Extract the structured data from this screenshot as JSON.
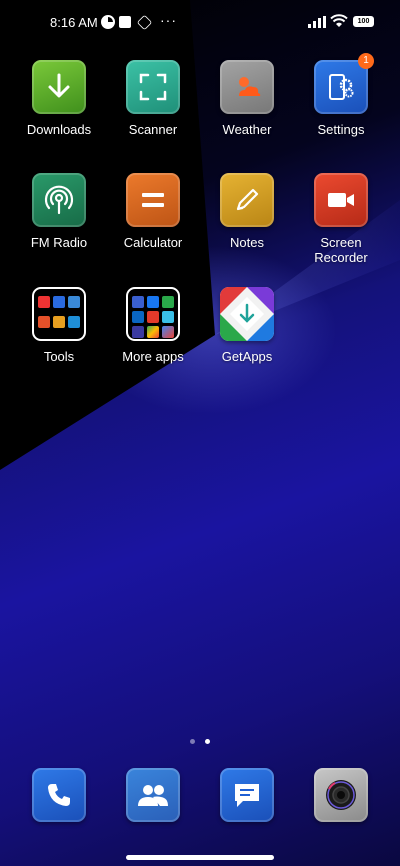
{
  "status_bar": {
    "time": "8:16 AM",
    "left_icons": [
      "data-saver-icon",
      "square-icon",
      "hex-icon",
      "more-dots-icon"
    ],
    "more_text": "···",
    "right_icons": [
      "signal-icon",
      "wifi-icon",
      "battery-icon"
    ],
    "battery_level": "100"
  },
  "apps": [
    {
      "label": "Downloads",
      "icon": "download-arrow-icon",
      "color": "#5aa52a"
    },
    {
      "label": "Scanner",
      "icon": "scan-frame-icon",
      "color": "#2aa88f"
    },
    {
      "label": "Weather",
      "icon": "weather-cloud-sun-icon",
      "color": "#8c8c8c"
    },
    {
      "label": "Settings",
      "icon": "phone-gear-icon",
      "color": "#1f5fd4",
      "badge": "1"
    },
    {
      "label": "FM Radio",
      "icon": "radio-antenna-icon",
      "color": "#1f8a5a"
    },
    {
      "label": "Calculator",
      "icon": "equals-icon",
      "color": "#d8661f"
    },
    {
      "label": "Notes",
      "icon": "pencil-icon",
      "color": "#d9a21f"
    },
    {
      "label": "Screen\nRecorder",
      "label_line1": "Screen",
      "label_line2": "Recorder",
      "icon": "video-camera-icon",
      "color": "#d83a25"
    },
    {
      "label": "Tools",
      "icon": "folder-icon"
    },
    {
      "label": "More apps",
      "icon": "folder-icon"
    },
    {
      "label": "GetApps",
      "icon": "getapps-diamond-icon"
    }
  ],
  "page_indicator": {
    "pages": 2,
    "active_page": 2
  },
  "dock": [
    {
      "name": "phone",
      "icon": "phone-handset-icon",
      "color": "#1f5fd4"
    },
    {
      "name": "contacts",
      "icon": "contacts-people-icon",
      "color": "#2d6fd0"
    },
    {
      "name": "messages",
      "icon": "message-bubble-icon",
      "color": "#1f5fd4"
    },
    {
      "name": "camera",
      "icon": "camera-lens-icon",
      "color": "#a8a8a8"
    }
  ]
}
